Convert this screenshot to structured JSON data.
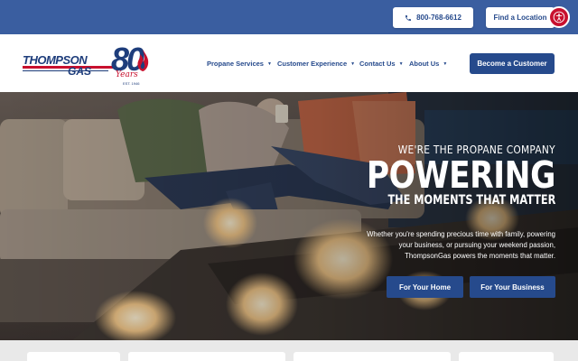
{
  "topbar": {
    "phone": "800-768-6612",
    "find_location": "Find a Location",
    "accessibility_icon": "accessibility-icon"
  },
  "logo": {
    "wordmark_line1": "THOMPSON",
    "wordmark_line2": "GAS",
    "anniversary_number": "80",
    "anniversary_word": "Years",
    "established": "EST. 1946"
  },
  "nav": {
    "items": [
      {
        "label": "Propane Services"
      },
      {
        "label": "Customer Experience"
      },
      {
        "label": "Contact Us"
      },
      {
        "label": "About Us"
      }
    ],
    "cta": "Become a Customer"
  },
  "hero": {
    "eyebrow": "WE'RE THE PROPANE COMPANY",
    "headline": "POWERING",
    "subhead": "THE MOMENTS THAT MATTER",
    "description": "Whether you're spending precious time with family, powering your business, or pursuing your weekend passion, ThompsonGas powers the moments that matter.",
    "buttons": {
      "home": "For Your Home",
      "business": "For Your Business"
    }
  },
  "colors": {
    "topbar": "#3a5ea0",
    "brand_blue": "#264a8c",
    "brand_red": "#c8102e"
  }
}
